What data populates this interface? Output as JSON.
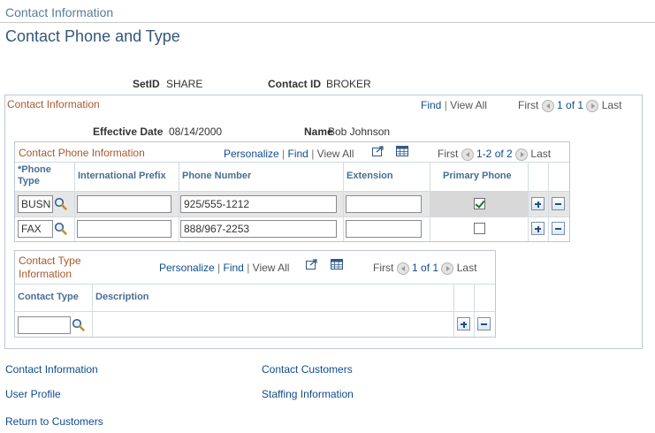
{
  "breadcrumb": "Contact Information",
  "page_title": "Contact Phone and Type",
  "key_fields": [
    {
      "label": "SetID",
      "value": "SHARE"
    },
    {
      "label": "Contact ID",
      "value": "BROKER"
    }
  ],
  "contact_info": {
    "title": "Contact Information",
    "nav": {
      "find": "Find",
      "view_all": "View All",
      "first": "First",
      "count": "1 of 1",
      "last": "Last",
      "sep": "|"
    },
    "effective_date_label": "Effective Date",
    "effective_date": "08/14/2000",
    "name_label": "Name",
    "name": "Bob Johnson"
  },
  "phone_grid": {
    "title": "Contact Phone Information",
    "nav": {
      "personalize": "Personalize",
      "find": "Find",
      "view_all": "View All",
      "first": "First",
      "count": "1-2 of 2",
      "last": "Last",
      "sep": "|"
    },
    "columns": [
      "*Phone Type",
      "International Prefix",
      "Phone Number",
      "Extension",
      "Primary Phone"
    ],
    "rows": [
      {
        "phone_type": "BUSN",
        "intl_prefix": "",
        "phone_number": "925/555-1212",
        "extension": "",
        "primary": true
      },
      {
        "phone_type": "FAX",
        "intl_prefix": "",
        "phone_number": "888/967-2253",
        "extension": "",
        "primary": false
      }
    ]
  },
  "type_grid": {
    "title": "Contact Type Information",
    "nav": {
      "personalize": "Personalize",
      "find": "Find",
      "view_all": "View All",
      "first": "First",
      "count": "1 of 1",
      "last": "Last",
      "sep": "|"
    },
    "columns": [
      "Contact Type",
      "Description"
    ],
    "rows": [
      {
        "contact_type": "",
        "description": ""
      }
    ]
  },
  "footer_links": {
    "contact_information": "Contact Information",
    "contact_customers": "Contact Customers",
    "user_profile": "User Profile",
    "staffing_information": "Staffing Information",
    "return_to_customers": "Return to Customers"
  },
  "colors": {
    "link": "#0f4c8e",
    "group_title": "#a65a2e",
    "page_title": "#33577a",
    "column_header": "#476f94"
  }
}
